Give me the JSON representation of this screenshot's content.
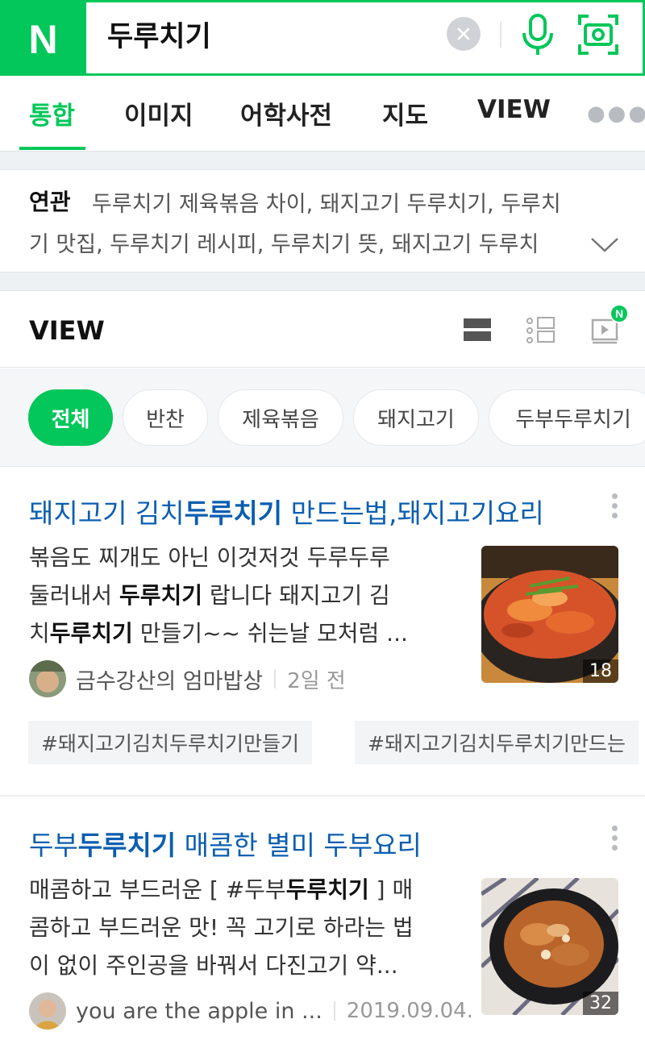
{
  "search": {
    "logo": "N",
    "query": "두루치기"
  },
  "tabs": [
    {
      "label": "통합",
      "active": true
    },
    {
      "label": "이미지"
    },
    {
      "label": "어학사전"
    },
    {
      "label": "지도"
    },
    {
      "label": "VIEW"
    }
  ],
  "related": {
    "label": "연관",
    "line1": "두루치기 제육볶음 차이, 돼지고기 두루치기, 두루치",
    "line2": "기 맛집, 두루치기 레시피, 두루치기 뜻, 돼지고기 두루치"
  },
  "view": {
    "title": "VIEW",
    "new_badge": "N",
    "chips": [
      "전체",
      "반찬",
      "제육볶음",
      "돼지고기",
      "두부두루치기"
    ]
  },
  "posts": [
    {
      "title_pre": "돼지고기 김치",
      "title_bold": "두루치기",
      "title_post": " 만드는법,돼지고기요리",
      "line1": "볶음도 찌개도 아닌 이것저것 두루두루",
      "line2_pre": "둘러내서 ",
      "line2_bold": "두루치기",
      "line2_post": " 랍니다 돼지고기 김",
      "line3_pre": "치",
      "line3_bold": "두루치기",
      "line3_post": " 만들기~~ 쉬는날 모처럼 ...",
      "image_count": "18",
      "author": "금수강산의 엄마밥상",
      "date": "2일 전",
      "tags": [
        "#돼지고기김치두루치기만들기",
        "#돼지고기김치두루치기만드는"
      ]
    },
    {
      "title_pre": "두부",
      "title_bold": "두루치기",
      "title_post": " 매콤한 별미 두부요리",
      "line1_pre": "매콤하고 부드러운 [ #두부",
      "line1_bold": "두루치기",
      "line1_post": " ] 매",
      "line2": "콤하고 부드러운 맛! 꼭 고기로 하라는 법",
      "line3": "이 없이 주인공을 바꿔서 다진고기 약...",
      "image_count": "32",
      "author": "you are the apple in ...",
      "date": "2019.09.04."
    }
  ],
  "colors": {
    "brand_green": "#03c75a",
    "link_blue": "#0b5eb0"
  }
}
